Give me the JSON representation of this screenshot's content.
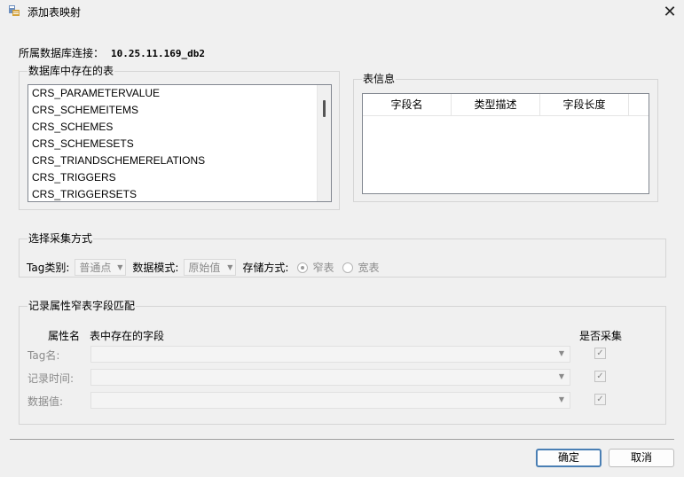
{
  "window": {
    "title": "添加表映射",
    "close_glyph": "✕"
  },
  "connection": {
    "label": "所属数据库连接：",
    "value": "10.25.11.169_db2"
  },
  "tables_group": {
    "legend": "数据库中存在的表",
    "items": [
      "CRS_PARAMETERVALUE",
      "CRS_SCHEMEITEMS",
      "CRS_SCHEMES",
      "CRS_SCHEMESETS",
      "CRS_TRIANDSCHEMERELATIONS",
      "CRS_TRIGGERS",
      "CRS_TRIGGERSETS"
    ]
  },
  "table_info": {
    "legend": "表信息",
    "columns": [
      "字段名",
      "类型描述",
      "字段长度"
    ]
  },
  "method_group": {
    "legend": "选择采集方式",
    "tag_type_label": "Tag类别:",
    "tag_type_value": "普通点",
    "data_mode_label": "数据模式:",
    "data_mode_value": "原始值",
    "storage_label": "存储方式:",
    "storage_options": [
      "窄表",
      "宽表"
    ],
    "storage_selected": "窄表"
  },
  "field_map": {
    "legend": "记录属性窄表字段匹配",
    "col_attr": "属性名",
    "col_field": "表中存在的字段",
    "col_collect": "是否采集",
    "rows": [
      {
        "label": "Tag名:",
        "checked": "✓"
      },
      {
        "label": "记录时间:",
        "checked": "✓"
      },
      {
        "label": "数据值:",
        "checked": "✓"
      }
    ]
  },
  "buttons": {
    "ok": "确定",
    "cancel": "取消"
  },
  "colors": {
    "background": "#f0f0f0",
    "primary_border": "#4a7fb4",
    "disabled_text": "#8a8a8a"
  }
}
